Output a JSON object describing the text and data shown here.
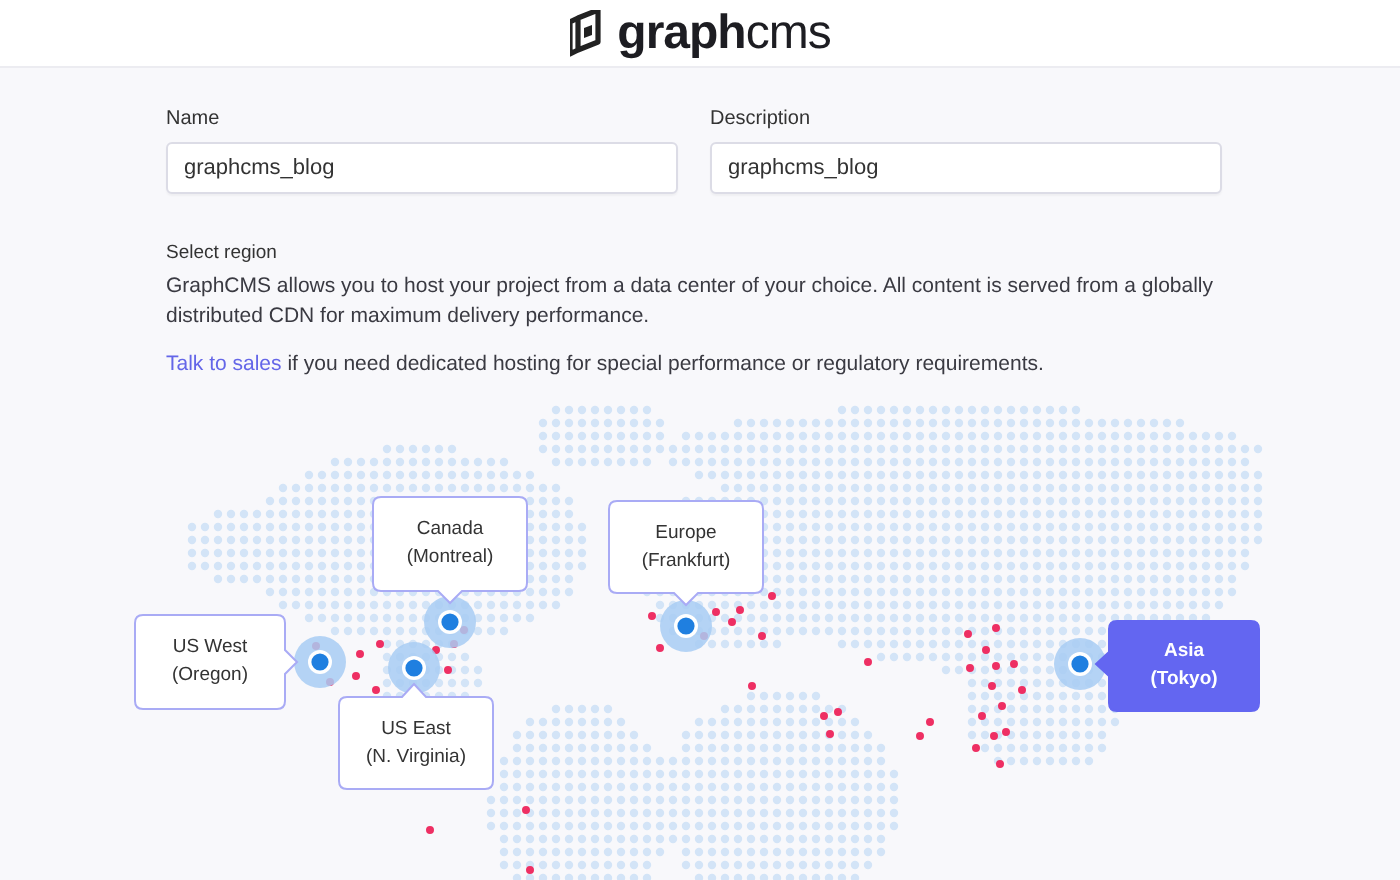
{
  "header": {
    "logo_text": "graph",
    "logo_suffix": "cms"
  },
  "fields": [
    {
      "label": "Name",
      "value": "graphcms_blog"
    },
    {
      "label": "Description",
      "value": "graphcms_blog"
    }
  ],
  "region_section": {
    "label": "Select region",
    "description": "GraphCMS allows you to host your project from a data center of your choice. All content is served from a globally distributed CDN for maximum delivery performance.",
    "link": "Talk to sales",
    "link_rest": " if you need dedicated hosting for special performance or regulatory requirements."
  },
  "regions": [
    {
      "name": "US West",
      "location": "(Oregon)",
      "selected": false
    },
    {
      "name": "Canada",
      "location": "(Montreal)",
      "selected": false
    },
    {
      "name": "US East",
      "location": "(N. Virginia)",
      "selected": false
    },
    {
      "name": "Europe",
      "location": "(Frankfurt)",
      "selected": false
    },
    {
      "name": "Asia",
      "location": "(Tokyo)",
      "selected": true
    }
  ]
}
